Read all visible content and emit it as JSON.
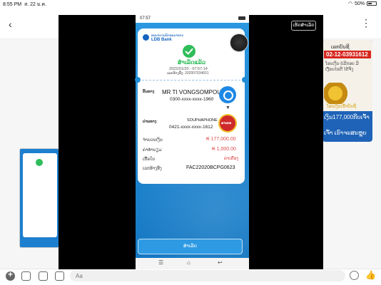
{
  "ipad_status": {
    "time": "8:55 PM",
    "date": "ส. 22 ม.ค.",
    "battery": "50%"
  },
  "viewer": {
    "done_label": "ເຮັດສຳເລັດ"
  },
  "phone_status": {
    "time": "07:57"
  },
  "receipt": {
    "bank_name_lao": "ທະນາຄານພັດທະນາລາວ",
    "bank_name": "LDB Bank",
    "status": "ສຳເລັດແລ້ວ",
    "datetime": "2022/01/20 - 07:57:14",
    "ref_line": "ເລກອ້າງອີງ: 202007034601",
    "from_label": "ຕົ້ນທາງ",
    "from_name": "MR TI VONGSOMPOU",
    "from_account": "0300-xxxx-xxxx-1960",
    "to_label": "ປາຍທາງ",
    "to_name": "SOUPHAPHONE",
    "to_account": "0421-xxxx-xxxx-1612",
    "bank_logo_text": "ລາວເອ",
    "amount_label": "ຈຳນວນເງິນ",
    "amount": "₭ 177,000.00",
    "fee_label": "ຄ່າທຳນຽມ",
    "fee": "₭ 1,000.00",
    "memo_label": "ເນື້ອໃນ",
    "memo": "ຄ່າເຄື່ອງ",
    "ref_label": "ເລກອ້າງອີງ",
    "ref": "FAC22020BCPG0623"
  },
  "close_button": "ສຳເລັດ",
  "chat": {
    "right_card": {
      "title": "ເລກບັນຊີ",
      "account": "02-12-03931612",
      "desc": "ໂອນເງິນ ບໍ່ມີກອບ ມີເງື່ອນໄຂດີ ໄດ້ຈິງ",
      "stamp": "ໂອນເງິນເຂົ້າບັນຊີ",
      "amount_msg": "ເງິນ177,000ກີບເຈົ້າ",
      "confirm_msg": "ເຈົ້າ ເຮົາຈະສະຫຼຸບ"
    },
    "input_placeholder": "Aa"
  }
}
